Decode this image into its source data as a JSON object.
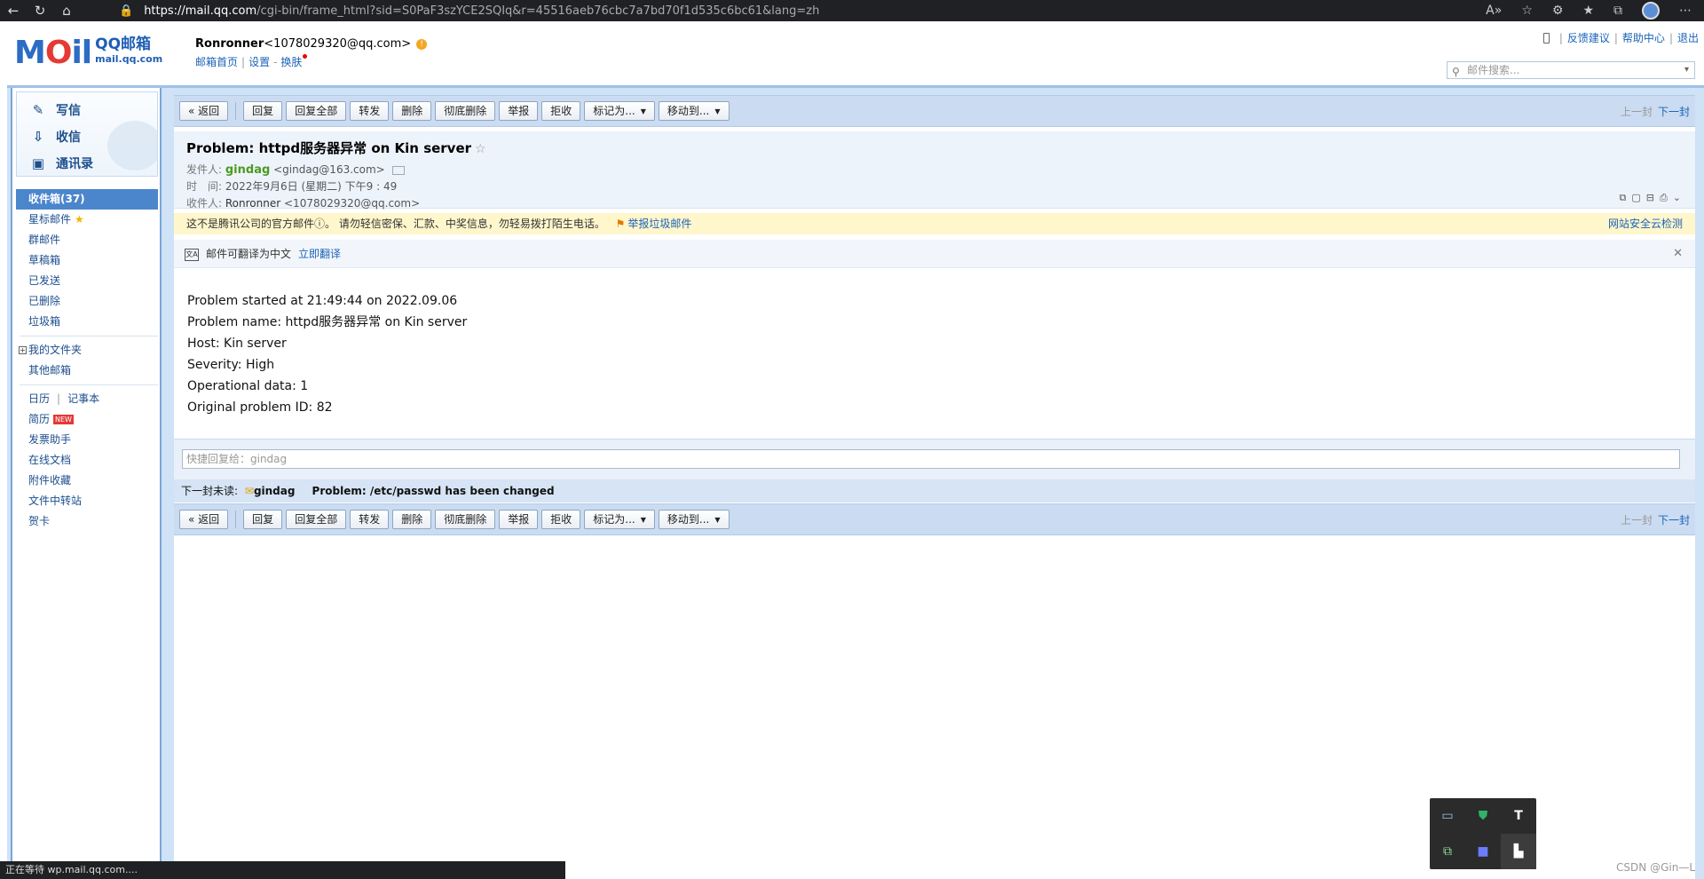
{
  "browser": {
    "url_host": "https://mail.qq.com",
    "url_path": "/cgi-bin/frame_html?sid=S0PaF3szYCE2SQIq&r=45516aeb76cbc7a7bd70f1d535c6bc61&lang=zh",
    "icons": [
      "back-icon",
      "refresh-icon",
      "home-icon",
      "lock-icon",
      "read-aloud-icon",
      "favorite-add-icon",
      "extensions-icon",
      "favorites-icon",
      "collections-icon",
      "profile-icon",
      "more-icon"
    ]
  },
  "header": {
    "logo_moil": "M",
    "logo_o": "O",
    "logo_il": "il",
    "logo_cn": "QQ邮箱",
    "logo_en": "mail.qq.com",
    "user_name": "Ronronner",
    "user_email": "<1078029320@qq.com>",
    "warn_glyph": "!",
    "link_home": "邮箱首页",
    "link_settings": "设置",
    "link_dash": "-",
    "link_skin": "换肤",
    "sep": "|",
    "top_feedback": "反馈建议",
    "top_help": "帮助中心",
    "top_logout": "退出",
    "search_placeholder": "邮件搜索..."
  },
  "sidebar": {
    "compose": "写信",
    "receive": "收信",
    "contacts": "通讯录",
    "inbox": "收件箱(37)",
    "starred": "星标邮件",
    "group": "群邮件",
    "drafts": "草稿箱",
    "sent": "已发送",
    "deleted": "已删除",
    "spam": "垃圾箱",
    "my_folders": "我的文件夹",
    "other_mail": "其他邮箱",
    "calendar": "日历",
    "cal_sep": "|",
    "notes": "记事本",
    "resume": "简历",
    "new_badge": "NEW",
    "invoice": "发票助手",
    "docs": "在线文档",
    "attach": "附件收藏",
    "transfer": "文件中转站",
    "card": "贺卡"
  },
  "toolbar": {
    "back": "« 返回",
    "reply": "回复",
    "reply_all": "回复全部",
    "forward": "转发",
    "delete": "删除",
    "delete_perm": "彻底删除",
    "report": "举报",
    "reject": "拒收",
    "mark_as": "标记为...",
    "move_to": "移动到...",
    "prev": "上一封",
    "next": "下一封"
  },
  "mail": {
    "subject": "Problem: httpd服务器异常 on Kin server",
    "from_label": "发件人:",
    "from_name": "gindag",
    "from_email": "<gindag@163.com>",
    "time_label": "时　间:",
    "time_value": "2022年9月6日 (星期二) 下午9 : 49",
    "to_label": "收件人:",
    "to_name": "Ronronner",
    "to_email": "<1078029320@qq.com>",
    "warning": "这不是腾讯公司的官方邮件ⓘ。 请勿轻信密保、汇款、中奖信息，勿轻易拨打陌生电话。",
    "report_spam": "举报垃圾邮件",
    "cloud_check": "网站安全云检测",
    "translate_hint": "邮件可翻译为中文",
    "translate_now": "立即翻译",
    "body_lines": [
      "Problem started at 21:49:44 on 2022.09.06",
      "Problem name: httpd服务器异常 on Kin server",
      "Host: Kin server",
      "Severity: High",
      "Operational data: 1",
      "Original problem ID: 82"
    ],
    "quick_reply_placeholder": "快捷回复给：gindag",
    "next_unread_label": "下一封未读:",
    "next_unread_sender": "gindag",
    "next_unread_subject": "Problem: /etc/passwd has been changed"
  },
  "status": {
    "loading": "正在等待 wp.mail.qq.com....",
    "watermark": "CSDN @Gin—L"
  },
  "tray": {
    "icons": [
      "display-icon",
      "security-shield-icon",
      "typora-icon",
      "copy-window-icon",
      "teams-icon",
      "bookmark-icon"
    ]
  }
}
